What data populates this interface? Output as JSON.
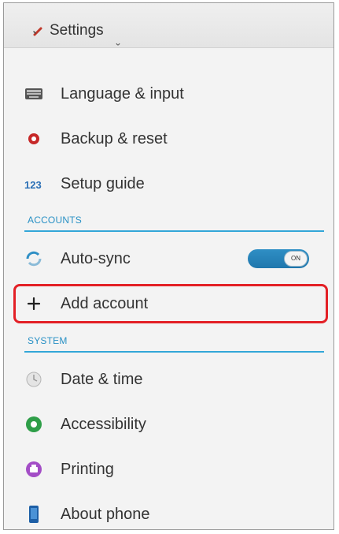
{
  "header": {
    "title": "Settings",
    "icon": "settings-icon"
  },
  "items_top": [
    {
      "label": "Language & input",
      "icon": "keyboard-icon"
    },
    {
      "label": "Backup & reset",
      "icon": "backup-icon"
    },
    {
      "label": "Setup guide",
      "icon": "123-icon"
    }
  ],
  "accounts": {
    "header": "ACCOUNTS",
    "autosync": {
      "label": "Auto-sync",
      "toggle_text": "ON",
      "icon": "sync-icon"
    },
    "add_account": {
      "label": "Add account",
      "icon": "plus-icon"
    }
  },
  "system": {
    "header": "SYSTEM",
    "items": [
      {
        "label": "Date & time",
        "icon": "clock-icon"
      },
      {
        "label": "Accessibility",
        "icon": "accessibility-icon"
      },
      {
        "label": "Printing",
        "icon": "printer-icon"
      },
      {
        "label": "About phone",
        "icon": "phone-icon"
      }
    ]
  },
  "colors": {
    "accent": "#33a6d8",
    "highlight": "#e32026",
    "toggle_on": "#1f77ad"
  }
}
